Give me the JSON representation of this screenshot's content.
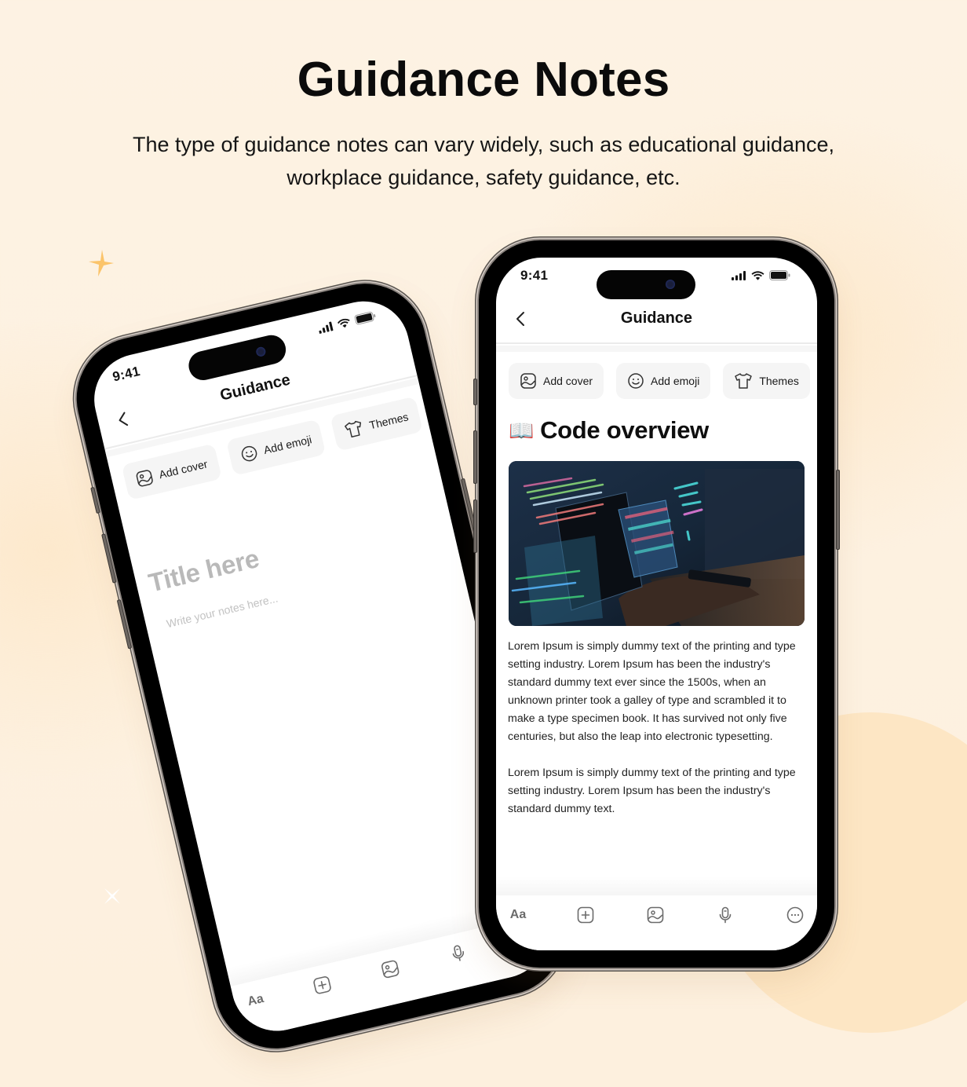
{
  "header": {
    "title": "Guidance Notes",
    "subtitle": "The type of guidance notes can vary widely, such as educational guidance, workplace guidance, safety guidance, etc."
  },
  "colors": {
    "background": "#fdf1e0",
    "accent_blob": "#fde6c4",
    "sparkle": "#fbc46a",
    "text_primary": "#0b0b0b",
    "placeholder": "#b9b9b9",
    "chip_bg": "#f5f5f5"
  },
  "phones": {
    "left": {
      "status": {
        "time": "9:41",
        "icons": [
          "signal-icon",
          "wifi-icon",
          "battery-icon"
        ]
      },
      "nav": {
        "title": "Guidance",
        "back_icon": "chevron-left-icon"
      },
      "chips": [
        {
          "label": "Add cover",
          "icon": "image-icon"
        },
        {
          "label": "Add emoji",
          "icon": "smiley-icon"
        },
        {
          "label": "Themes",
          "icon": "tshirt-icon"
        }
      ],
      "title_placeholder": "Title here",
      "notes_placeholder": "Write your notes here...",
      "toolbar": [
        {
          "label": "Aa",
          "icon": "text-format-icon"
        },
        {
          "label": "",
          "icon": "add-square-icon"
        },
        {
          "label": "",
          "icon": "image-icon"
        },
        {
          "label": "",
          "icon": "microphone-icon"
        }
      ]
    },
    "right": {
      "status": {
        "time": "9:41",
        "icons": [
          "signal-icon",
          "wifi-icon",
          "battery-icon"
        ]
      },
      "nav": {
        "title": "Guidance",
        "back_icon": "chevron-left-icon"
      },
      "chips": [
        {
          "label": "Add cover",
          "icon": "image-icon"
        },
        {
          "label": "Add emoji",
          "icon": "smiley-icon"
        },
        {
          "label": "Themes",
          "icon": "tshirt-icon"
        }
      ],
      "note": {
        "emoji": "📖",
        "title": "Code overview",
        "cover_image": "code-on-screen-photo",
        "paragraphs": [
          "Lorem Ipsum is simply dummy text of the printing and type setting industry. Lorem Ipsum has been the industry's standard dummy text ever since the 1500s, when an unknown printer took a galley of type and scrambled it to make a type specimen book. It has survived not only five centuries, but also the leap into electronic typesetting.",
          "Lorem Ipsum is simply dummy text of the printing and type setting industry. Lorem Ipsum has been the industry's standard dummy text."
        ]
      },
      "toolbar": [
        {
          "label": "Aa",
          "icon": "text-format-icon"
        },
        {
          "label": "",
          "icon": "add-square-icon"
        },
        {
          "label": "",
          "icon": "image-icon"
        },
        {
          "label": "",
          "icon": "microphone-icon"
        },
        {
          "label": "",
          "icon": "more-circle-icon"
        }
      ]
    }
  }
}
